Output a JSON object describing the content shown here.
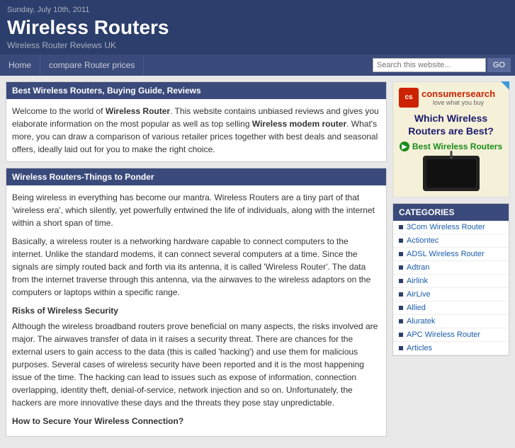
{
  "header": {
    "date": "Sunday, July 10th, 2011",
    "title": "Wireless Routers",
    "subtitle": "Wireless Router Reviews UK"
  },
  "navbar": {
    "items": [
      {
        "label": "Home"
      },
      {
        "label": "compare Router prices"
      }
    ],
    "search_placeholder": "Search this website...",
    "search_button": "GO"
  },
  "main_sections": [
    {
      "heading": "Best Wireless Routers, Buying Guide, Reviews",
      "paragraphs": [
        "Welcome to the world of Wireless Router. This website contains unbiased reviews and gives you elaborate information on the most popular as well as top selling Wireless modem router. What's more, you can draw a comparison of various retailer prices together with best deals and seasonal offers, ideally laid out for you to make the right choice."
      ]
    },
    {
      "heading": "Wireless Routers-Things to Ponder",
      "paragraphs": [
        "Being wireless in everything has become our mantra. Wireless Routers are a tiny part of that 'wireless era', which silently, yet powerfully entwined the life of individuals, along with the internet within a short span of time.",
        "Basically, a wireless router is a networking hardware capable to connect computers to the internet. Unlike the standard modems, it can connect several computers at a time. Since the signals are simply routed back and forth via its antenna, it is called 'Wireless Router'. The data from the internet traverse through this antenna, via the airwaves to the wireless adaptors on the computers or laptops within a specific range.",
        "Risks of Wireless Security",
        "Although the wireless broadband routers prove beneficial on many aspects, the risks involved are major. The airwaves transfer of data in it raises a security threat. There are chances for the external users to gain access to the data (this is called 'hacking') and use them for malicious purposes. Several cases of wireless security have been reported and it is the most happening issue of the time. The hacking can lead to issues such as expose of information, connection overlapping, identity theft, denial-of-service, network injection and so on. Unfortunately, the hackers are more innovative these days and the threats they pose stay unpredictable.",
        "How to Secure Your Wireless Connection?"
      ]
    }
  ],
  "ad": {
    "brand": "consumersearch",
    "tagline": "love what you buy",
    "question": "Which Wireless Routers are Best?",
    "link_text": "Best Wireless Routers"
  },
  "categories": {
    "heading": "CATEGORIES",
    "items": [
      "3Com Wireless Router",
      "Actiontec",
      "ADSL Wireless Router",
      "Adtran",
      "Airlink",
      "AirLive",
      "Allied",
      "Aluratek",
      "APC Wireless Router",
      "Articles"
    ]
  }
}
